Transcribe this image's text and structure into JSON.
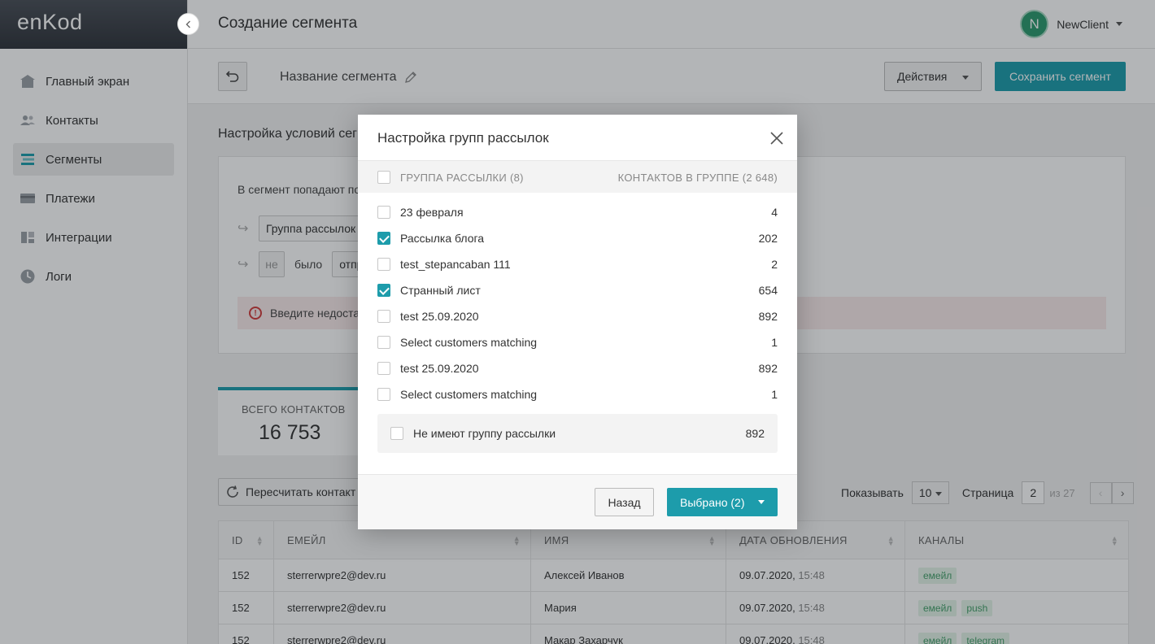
{
  "app": {
    "logo": "enKod"
  },
  "sidebar": {
    "items": [
      {
        "label": "Главный экран",
        "icon": "home-icon",
        "active": false
      },
      {
        "label": "Контакты",
        "icon": "contacts-icon",
        "active": false
      },
      {
        "label": "Сегменты",
        "icon": "segments-icon",
        "active": true
      },
      {
        "label": "Платежи",
        "icon": "card-icon",
        "active": false
      },
      {
        "label": "Интеграции",
        "icon": "integrations-icon",
        "active": false
      },
      {
        "label": "Логи",
        "icon": "logs-icon",
        "active": false
      }
    ]
  },
  "header": {
    "title": "Создание сегмента",
    "user": {
      "initial": "N",
      "name": "NewClient",
      "avatar_color": "#2c9a6e"
    }
  },
  "toolbar": {
    "segment_name": "Название сегмента",
    "actions_label": "Действия",
    "save_label": "Сохранить сегмент"
  },
  "conditions": {
    "title": "Настройка условий сег",
    "intro": "В сегмент попадают по",
    "field1": "Группа рассылок",
    "not_label": "не",
    "was_label": "было",
    "field2": "отпра",
    "error": "Введите недоста"
  },
  "stats": {
    "label": "ВСЕГО КОНТАКТОВ",
    "value": "16 753"
  },
  "list_controls": {
    "recalc_label": "Пересчитать контакт",
    "show_label": "Показывать",
    "page_size": "10",
    "page_label": "Страница",
    "page": "2",
    "of_label": "из 27"
  },
  "table": {
    "columns": [
      "ID",
      "ЕМЕЙЛ",
      "ИМЯ",
      "ДАТА ОБНОВЛЕНИЯ",
      "КАНАЛЫ"
    ],
    "rows": [
      {
        "id": "152",
        "email": "sterrerwpre2@dev.ru",
        "name": "Алексей Иванов",
        "date": "09.07.2020,",
        "time": "15:48",
        "channels": [
          "емейл"
        ]
      },
      {
        "id": "152",
        "email": "sterrerwpre2@dev.ru",
        "name": "Мария",
        "date": "09.07.2020,",
        "time": "15:48",
        "channels": [
          "емейл",
          "push"
        ]
      },
      {
        "id": "152",
        "email": "sterrerwpre2@dev.ru",
        "name": "Макар Захарчук",
        "date": "09.07.2020,",
        "time": "15:48",
        "channels": [
          "емейл",
          "telegram"
        ]
      }
    ]
  },
  "modal": {
    "title": "Настройка групп рассылок",
    "head_left": "ГРУППА РАССЫЛКИ (8)",
    "head_right": "КОНТАКТОВ В ГРУППЕ (2 648)",
    "groups": [
      {
        "name": "23 февраля",
        "count": "4",
        "checked": false
      },
      {
        "name": "Рассылка блога",
        "count": "202",
        "checked": true
      },
      {
        "name": "test_stepancaban 111",
        "count": "2",
        "checked": false
      },
      {
        "name": "Странный лист",
        "count": "654",
        "checked": true
      },
      {
        "name": "test 25.09.2020",
        "count": "892",
        "checked": false
      },
      {
        "name": "Select customers matching",
        "count": "1",
        "checked": false
      },
      {
        "name": "test 25.09.2020",
        "count": "892",
        "checked": false
      },
      {
        "name": "Select customers matching",
        "count": "1",
        "checked": false
      }
    ],
    "no_group": {
      "name": "Не имеют группу рассылки",
      "count": "892",
      "checked": false
    },
    "back_label": "Назад",
    "selected_label": "Выбрано (2)"
  },
  "colors": {
    "accent": "#1d9cab",
    "tag_bg": "#e3f3e8",
    "tag_text": "#45a06a",
    "error_bg": "#f9eaea"
  }
}
